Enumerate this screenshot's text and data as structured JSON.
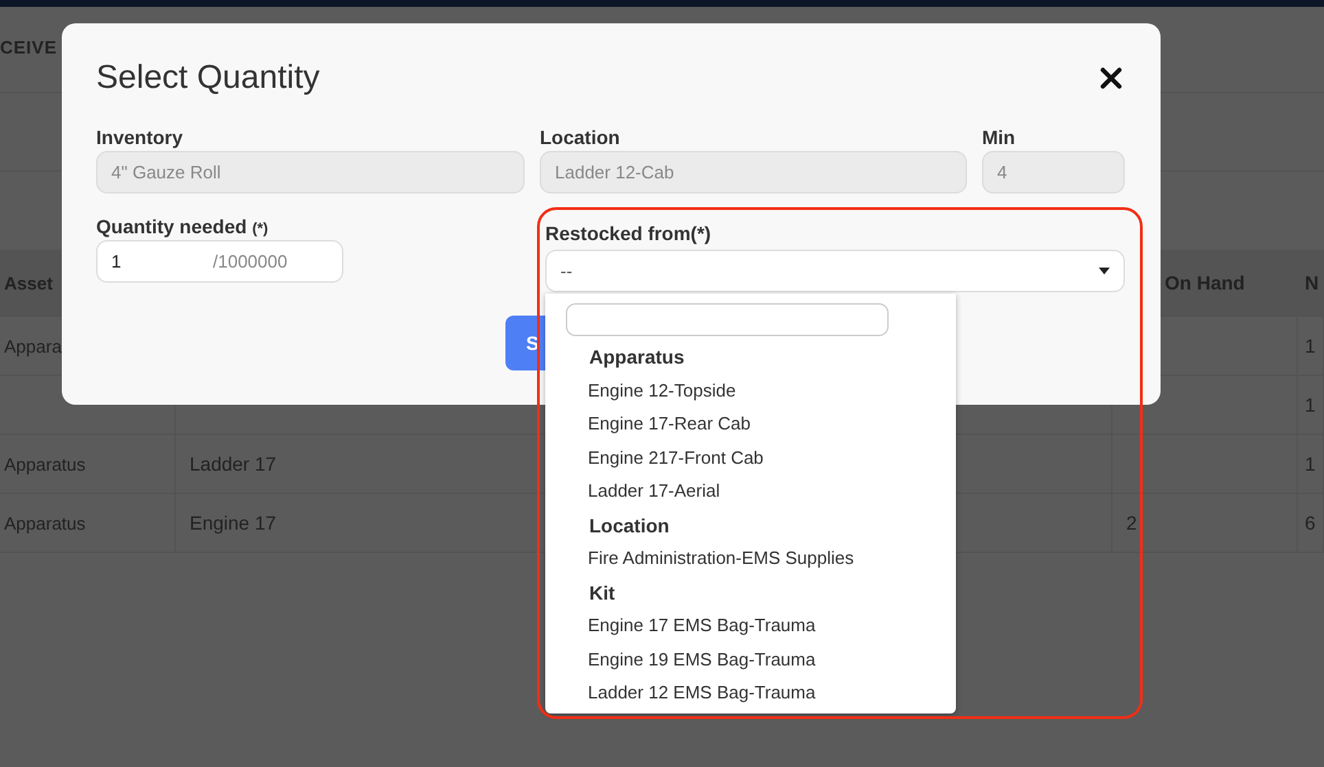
{
  "page": {
    "heading": "CEIVE",
    "table": {
      "header": {
        "column_1": "Asset",
        "on_hand": "On Hand",
        "column_4": "N"
      },
      "rows": [
        {
          "column_1": "Appara",
          "column_4": "1"
        },
        {
          "column_4": "1"
        },
        {
          "column_1": "Apparatus",
          "column_2": "Ladder 17",
          "column_4": "1"
        },
        {
          "column_1": "Apparatus",
          "column_2": "Engine 17",
          "on_hand": "2",
          "column_4": "6"
        }
      ]
    }
  },
  "dialog": {
    "title": "Select Quantity",
    "fields": [
      {
        "label": "Inventory",
        "value": "4\" Gauze Roll",
        "disabled": true
      },
      {
        "label": "Location",
        "value": "Ladder 12-Cab",
        "disabled": true
      },
      {
        "label": "Min",
        "value": "4",
        "disabled": true
      }
    ],
    "quantity": {
      "label": "Quantity needed",
      "required_mark": "(*)",
      "value": "1",
      "suffix": "/1000000",
      "disabled": false
    },
    "restocked_from": {
      "label": "Restocked from(*)",
      "value": "--",
      "expanded": true,
      "groups": [
        {
          "label": "Apparatus",
          "options": [
            "Engine 12-Topside",
            "Engine 17-Rear Cab",
            "Engine 217-Front Cab",
            "Ladder 17-Aerial"
          ]
        },
        {
          "label": "Location",
          "options": [
            "Fire Administration-EMS Supplies"
          ]
        },
        {
          "label": "Kit",
          "options": [
            "Engine 17 EMS Bag-Trauma",
            "Engine 19 EMS Bag-Trauma",
            "Ladder 12 EMS Bag-Trauma"
          ]
        }
      ]
    },
    "save_button": "S"
  }
}
